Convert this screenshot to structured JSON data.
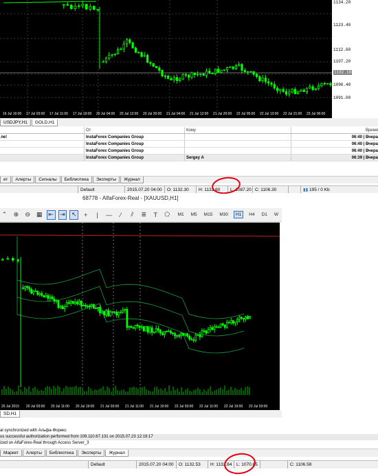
{
  "window1": {
    "y_ticks": [
      "1134.20",
      "1123.40",
      "1112.60",
      "1107.20",
      "1101.80",
      "1096.40",
      "1091.00"
    ],
    "price_label": "1102.10",
    "x_ticks": [
      "16 Jul 16:00",
      "17 Jul 03:00",
      "17 Jul 11:00",
      "17 Jul 19:00",
      "20 Jul 04:00",
      "20 Jul 12:00",
      "20 Jul 20:00",
      "21 Jul 04:00",
      "21 Jul 12:00",
      "21 Jul 20:00",
      "22 Jul 05:00",
      "22 Jul 13:00",
      "22 Jul 21:00",
      "23 Jul 06:00"
    ],
    "tabs": [
      "USDJPY,H1",
      "GOLD,H1"
    ],
    "table": {
      "headers": [
        "",
        "От",
        "Кому",
        "Время"
      ],
      "rows": [
        [
          "ле!",
          "InstaForex Companies Group",
          "",
          "06:40 | Вчера"
        ],
        [
          "",
          "InstaForex Companies Group",
          "",
          "06:40 | Вчера"
        ],
        [
          "",
          "InstaForex Companies Group",
          "",
          "06:40 | Вчера"
        ],
        [
          "",
          "InstaForex Companies Group",
          "Sergey A",
          "06:39 | Вчера"
        ]
      ]
    },
    "terminal_tabs": [
      "ет",
      "Алерты",
      "Сигналы",
      "Библиотека",
      "Эксперты",
      "Журнал"
    ],
    "status": {
      "profile": "Default",
      "time": "2015.07.20 04:00",
      "open": "O: 1132.30",
      "high": "H: 1132.60",
      "low": "L: 1087.20",
      "close": "C: 1106.30",
      "traffic": "195 / 0 Kb"
    }
  },
  "window2": {
    "title": "68778 - AlfaForex-Real - [XAUUSD,H1]",
    "timeframes": [
      "M1",
      "M5",
      "M15",
      "M30",
      "H1",
      "H4",
      "D1",
      "W"
    ],
    "active_timeframe": "H1",
    "x_ticks": [
      "20 Jul 2015",
      "20 Jul 03:00",
      "20 Jul 11:00",
      "20 Jul 19:00",
      "21 Jul 03:00",
      "21 Jul 11:00",
      "21 Jul 19:00",
      "22 Jul 03:00",
      "22 Jul 11:00",
      "22 Jul 19:00",
      "23 Jul 03:00"
    ],
    "sub_tab": "SD,H1",
    "log": [
      "al synchronized with Альфа-Форекс",
      "us successful authorization performed from 109.110.67.131 on 2015.07.23 12:19:17",
      "ized on AlfaForex-Real through Access Server_3"
    ],
    "terminal_tabs": [
      "Маркет",
      "Алерты",
      "Библиотека",
      "Эксперты",
      "Журнал"
    ],
    "status": {
      "profile": "Default",
      "time": "2015.07.20 04:00",
      "open": "O: 1132.53",
      "high": "H: 1132.84",
      "low": "L: 1070.85",
      "close": "C: 1106.58"
    }
  },
  "colors": {
    "candle": "#00ff00",
    "chart_bg": "#000000",
    "band": "#1f9f3f",
    "mark": "#e00010",
    "ma_red": "#cc2020"
  }
}
